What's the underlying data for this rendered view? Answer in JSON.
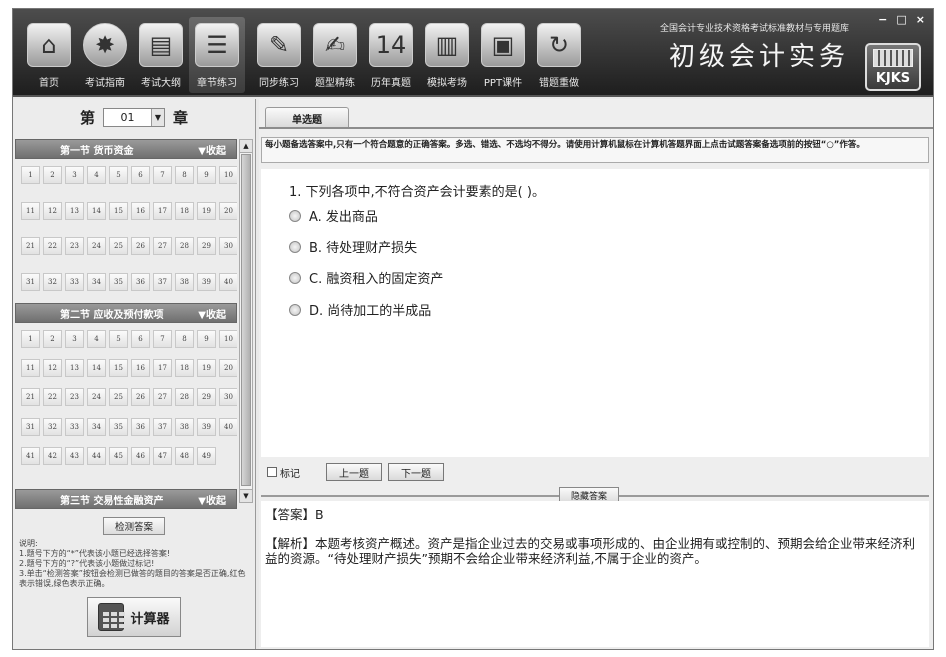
{
  "window": {
    "min": "−",
    "max": "□",
    "close": "×"
  },
  "toolbar": [
    {
      "label": "首页",
      "icon": "home-icon",
      "glyph": "⌂"
    },
    {
      "label": "考试指南",
      "icon": "compass-icon",
      "glyph": "✸"
    },
    {
      "label": "考试大纲",
      "icon": "outline-book-icon",
      "glyph": "▤"
    },
    {
      "label": "章节练习",
      "icon": "chapter-list-icon",
      "glyph": "☰",
      "active": true
    },
    {
      "label": "同步练习",
      "icon": "pen-practice-icon",
      "glyph": "✎"
    },
    {
      "label": "题型精练",
      "icon": "notepad-icon",
      "glyph": "✍"
    },
    {
      "label": "历年真题",
      "icon": "calendar-icon",
      "glyph": "14"
    },
    {
      "label": "模拟考场",
      "icon": "exam-door-icon",
      "glyph": "▥"
    },
    {
      "label": "PPT课件",
      "icon": "ppt-icon",
      "glyph": "▣"
    },
    {
      "label": "错题重做",
      "icon": "redo-icon",
      "glyph": "↻"
    }
  ],
  "brand": {
    "subtitle": "全国会计专业技术资格考试标准教材与专用题库",
    "title": "初级会计实务",
    "logo_text": "KJKS"
  },
  "chapter": {
    "prefix": "第",
    "value": "01",
    "suffix": "章"
  },
  "sections": [
    {
      "title": "第一节  货币资金",
      "collapse": "▼收起",
      "count": 40
    },
    {
      "title": "第二节  应收及预付款项",
      "collapse": "▼收起",
      "count": 49
    },
    {
      "title": "第三节  交易性金融资产",
      "collapse": "▼收起",
      "count": 0
    }
  ],
  "left_panel": {
    "check_button": "检测答案",
    "notes": [
      "说明:",
      "1.题号下方的“*”代表该小题已经选择答案!",
      "2.题号下方的“?”代表该小题做过标记!",
      "3.单击“检测答案”按钮会检测已做答的题目的答案是否正确,红色表示错误,绿色表示正确。"
    ],
    "calculator": "计算器"
  },
  "main": {
    "tab": "单选题",
    "instruction": "每小题备选答案中,只有一个符合题意的正确答案。多选、错选、不选均不得分。请使用计算机鼠标在计算机答题界面上点击试题答案备选项前的按钮“○”作答。",
    "question": "1. 下列各项中,不符合资产会计要素的是(    )。",
    "options": [
      "A.  发出商品",
      "B.  待处理财产损失",
      "C.  融资租入的固定资产",
      "D.  尚待加工的半成品"
    ],
    "mark_label": "标记",
    "prev_button": "上一题",
    "next_button": "下一题",
    "hide_answer_button": "隐藏答案",
    "answer": "【答案】B",
    "analysis": "【解析】本题考核资产概述。资产是指企业过去的交易或事项形成的、由企业拥有或控制的、预期会给企业带来经济利益的资源。“待处理财产损失”预期不会给企业带来经济利益,不属于企业的资产。"
  }
}
